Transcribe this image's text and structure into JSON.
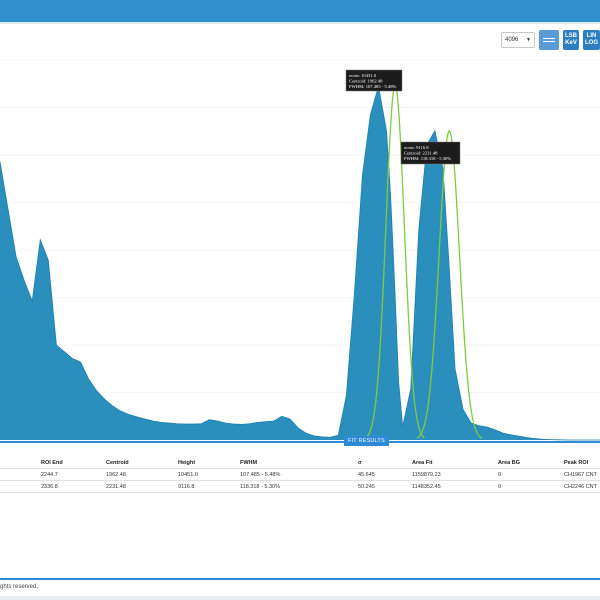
{
  "controls": {
    "channels_select": "4096",
    "energy_button_line1": "LSB",
    "energy_button_line2": "KeV",
    "scale_button_line1": "LIN",
    "scale_button_line2": "LOG"
  },
  "tooltips": [
    {
      "line1": "ocnts: 10431.0",
      "line2": "Centroid: 1962.48",
      "line3": "FWHM: 107.485 - 5.48%"
    },
    {
      "line1": "ocnts: 9116.8",
      "line2": "Centroid: 2231.48",
      "line3": "FWHM: 118.318 - 5.30%"
    }
  ],
  "colors": {
    "topbar": "#2f8fcf",
    "histogram": "#2a8fbd",
    "fit_curve": "#7ecb40",
    "accent": "#2d8ad6"
  },
  "chart_data": {
    "type": "area",
    "series": [
      {
        "x": [
          0,
          40,
          80,
          120,
          160,
          200,
          240,
          280,
          320,
          360,
          400,
          440,
          480,
          520,
          560,
          600,
          640,
          680,
          720,
          760,
          800,
          840,
          880,
          920,
          960,
          1000,
          1040,
          1080,
          1120,
          1160,
          1200,
          1240,
          1280,
          1320,
          1360,
          1400,
          1440,
          1480,
          1520,
          1560,
          1600,
          1640,
          1680,
          1720,
          1760,
          1800,
          1840,
          1880,
          1920,
          1940,
          1960,
          1980,
          2000,
          2040,
          2080,
          2120,
          2160,
          2200,
          2230,
          2260,
          2300,
          2340,
          2380,
          2420,
          2460,
          2500,
          2540,
          2580,
          2620,
          2660,
          2700,
          2740,
          2780,
          2820,
          2860,
          2900,
          2940,
          2980
        ],
        "y": [
          8200,
          6800,
          5400,
          4700,
          4100,
          5900,
          5300,
          2800,
          2600,
          2400,
          2300,
          1800,
          1450,
          1200,
          1000,
          850,
          750,
          680,
          620,
          560,
          520,
          500,
          480,
          470,
          470,
          480,
          600,
          560,
          500,
          470,
          460,
          480,
          520,
          540,
          560,
          700,
          620,
          360,
          200,
          120,
          90,
          80,
          140,
          1300,
          4300,
          7800,
          9600,
          10431,
          9100,
          7200,
          4600,
          1700,
          400,
          1500,
          6200,
          8700,
          9116,
          8000,
          5200,
          2100,
          900,
          500,
          420,
          380,
          300,
          200,
          150,
          110,
          70,
          40,
          20,
          10,
          5,
          0,
          0,
          0,
          0,
          0
        ]
      }
    ],
    "peaks": [
      {
        "centroid": 1962.48,
        "height": 10451.0
      },
      {
        "centroid": 2231.48,
        "height": 9116.8
      }
    ]
  },
  "fit_results": {
    "title": "FIT RESULTS",
    "headers": [
      "ROI End",
      "Centroid",
      "Height",
      "FWHM",
      "σ",
      "Area Fit",
      "Area BG",
      "Peak ROI"
    ],
    "rows": [
      [
        "2244.7",
        "1962.48",
        "10451.0",
        "107.485 - 5.48%",
        "45.645",
        "1159879.23",
        "0",
        "CH1967 CNT"
      ],
      [
        "2336.8",
        "2231.48",
        "9116.8",
        "118.318 - 5.30%",
        "50.245",
        "1148352.45",
        "0",
        "CH2246 CNT"
      ]
    ]
  },
  "footer": {
    "text": "ghts reserved."
  }
}
